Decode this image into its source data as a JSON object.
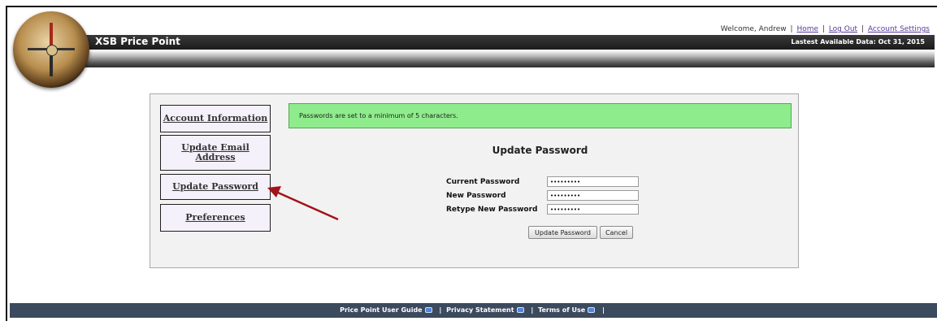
{
  "header": {
    "welcome": "Welcome, Andrew",
    "links": {
      "home": "Home",
      "logout": "Log Out",
      "settings": "Account Settings"
    },
    "separator": "|",
    "app_title": "XSB Price Point",
    "latest_data": "Lastest Available Data: Oct 31, 2015"
  },
  "sidebar": {
    "items": [
      {
        "label": "Account Information"
      },
      {
        "label": "Update Email Address"
      },
      {
        "label": "Update Password"
      },
      {
        "label": "Preferences"
      }
    ]
  },
  "notice": {
    "text": "Passwords are set to a minimum of 5 characters."
  },
  "form": {
    "title": "Update Password",
    "fields": [
      {
        "label": "Current Password",
        "value": "•••••••••"
      },
      {
        "label": "New Password",
        "value": "•••••••••"
      },
      {
        "label": "Retype New Password",
        "value": "•••••••••"
      }
    ],
    "update_label": "Update Password",
    "cancel_label": "Cancel"
  },
  "footer": {
    "links": [
      {
        "label": "Price Point User Guide"
      },
      {
        "label": "Privacy Statement"
      },
      {
        "label": "Terms of Use"
      }
    ],
    "separator": "|"
  },
  "colors": {
    "notice_bg": "#8fec8c",
    "footer_bg": "#3c4a5e",
    "titlebar_bg": "#1b1b1b",
    "annotation_arrow": "#a3131a"
  },
  "icons": {
    "logo": "compass-logo-icon",
    "external": "external-link-icon"
  }
}
